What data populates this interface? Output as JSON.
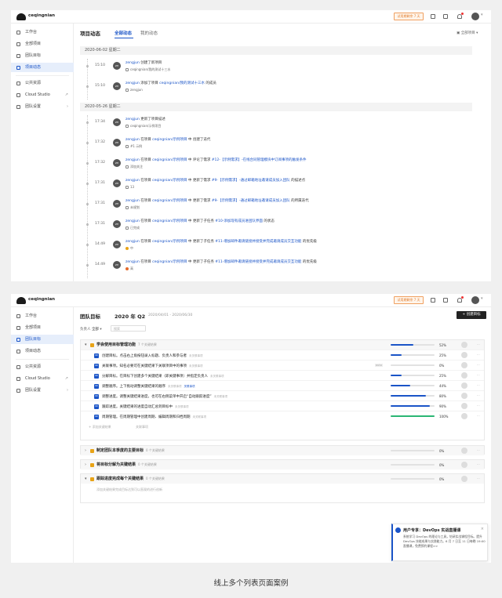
{
  "app": {
    "brand": "ceqingnian",
    "trial": "试用期剩余 7 天",
    "user_avatar": "ZH"
  },
  "sidebar": {
    "items": [
      {
        "label": "工作台"
      },
      {
        "label": "全部项目"
      },
      {
        "label": "团队目标"
      },
      {
        "label": "项目动态"
      },
      {
        "label": "公共资源"
      },
      {
        "label": "Cloud Studio",
        "arrow": "↗"
      },
      {
        "label": "团队设置",
        "arrow": "›"
      }
    ]
  },
  "activity": {
    "title": "项目动态",
    "tabs": [
      "全部动态",
      "我的动态"
    ],
    "filter": "全部项目",
    "groups": [
      {
        "date": "2020-06-02 星期二",
        "events": [
          {
            "time": "15:10",
            "avatar": "ZH",
            "line1": [
              {
                "t": "zengjun",
                "c": "blue"
              },
              {
                "t": " 创建了新项目",
                "c": ""
              }
            ],
            "line2": "ceqingnian/我的测试十三水"
          },
          {
            "time": "15:10",
            "avatar": "ZH",
            "line1": [
              {
                "t": "zengjun",
                "c": "blue"
              },
              {
                "t": " 添加了项目 ",
                "c": ""
              },
              {
                "t": "ceqingnian/我的测试十三水",
                "c": "blue"
              },
              {
                "t": " 的成员",
                "c": ""
              }
            ],
            "line2": "zengjun"
          }
        ]
      },
      {
        "date": "2020-05-26 星期二",
        "events": [
          {
            "time": "17:34",
            "avatar": "ZH",
            "line1": [
              {
                "t": "zengjun",
                "c": "blue"
              },
              {
                "t": " 更新了项目描述",
                "c": ""
              }
            ],
            "line2": "ceqingnian/示例项目"
          },
          {
            "time": "17:32",
            "avatar": "ZH",
            "line1": [
              {
                "t": "zengjun",
                "c": "blue"
              },
              {
                "t": " 在项目 ",
                "c": ""
              },
              {
                "t": "ceqingnian/示例项目",
                "c": "blue"
              },
              {
                "t": " 中 创建了迭代",
                "c": ""
              }
            ],
            "line2": "#1 示例"
          },
          {
            "time": "17:32",
            "avatar": "ZH",
            "line1": [
              {
                "t": "zengjun",
                "c": "blue"
              },
              {
                "t": " 在项目 ",
                "c": ""
              },
              {
                "t": "ceqingnian/示例项目",
                "c": "blue"
              },
              {
                "t": " 中 评论了需求 ",
                "c": ""
              },
              {
                "t": "#12-【示例需求】-在线合同管理模块中订阅事项的触发条件",
                "c": "blue"
              }
            ],
            "line2": "添加关注"
          },
          {
            "time": "17:31",
            "avatar": "ZH",
            "line1": [
              {
                "t": "zengjun",
                "c": "blue"
              },
              {
                "t": " 在项目 ",
                "c": ""
              },
              {
                "t": "ceqingnian/示例项目",
                "c": "blue"
              },
              {
                "t": " 中 更新了需求 ",
                "c": ""
              },
              {
                "t": "#9-【示例需求】-通过邮箱地址邀请成员加入团队",
                "c": "blue"
              },
              {
                "t": " 的描述点",
                "c": ""
              }
            ],
            "line2": "13"
          },
          {
            "time": "17:31",
            "avatar": "ZH",
            "line1": [
              {
                "t": "zengjun",
                "c": "blue"
              },
              {
                "t": " 在项目 ",
                "c": ""
              },
              {
                "t": "ceqingnian/示例项目",
                "c": "blue"
              },
              {
                "t": " 中 更新了需求 ",
                "c": ""
              },
              {
                "t": "#9-【示例需求】-通过邮箱地址邀请成员加入团队",
                "c": "blue"
              },
              {
                "t": " 的所属迭代",
                "c": ""
              }
            ],
            "line2": "未规划"
          },
          {
            "time": "17:31",
            "avatar": "ZH",
            "line1": [
              {
                "t": "zengjun",
                "c": "blue"
              },
              {
                "t": " 在项目 ",
                "c": ""
              },
              {
                "t": "ceqingnian/示例项目",
                "c": "blue"
              },
              {
                "t": " 中 更新了子任务 ",
                "c": ""
              },
              {
                "t": "#10-添加现有成员进团队界面",
                "c": "blue"
              },
              {
                "t": " 的状态",
                "c": ""
              }
            ],
            "line2": "已完成"
          },
          {
            "time": "14:49",
            "avatar": "ZH",
            "line1": [
              {
                "t": "zengjun",
                "c": "blue"
              },
              {
                "t": " 在项目 ",
                "c": ""
              },
              {
                "t": "ceqingnian/示例项目",
                "c": "blue"
              },
              {
                "t": " 中 更新了子任务 ",
                "c": ""
              },
              {
                "t": "#11-增加邮件邀请链接并接受并完成邀请成员交互功能",
                "c": "blue"
              },
              {
                "t": " 的优先级",
                "c": ""
              }
            ],
            "line2": "中",
            "pri": "mid"
          },
          {
            "time": "14:49",
            "avatar": "ZH",
            "line1": [
              {
                "t": "zengjun",
                "c": "blue"
              },
              {
                "t": " 在项目 ",
                "c": ""
              },
              {
                "t": "ceqingnian/示例项目",
                "c": "blue"
              },
              {
                "t": " 中 更新了子任务 ",
                "c": ""
              },
              {
                "t": "#11-增加邮件邀请链接并接受并完成邀请成员交互功能",
                "c": "blue"
              },
              {
                "t": " 的优先级",
                "c": ""
              }
            ],
            "line2": "高",
            "pri": "high"
          }
        ]
      }
    ]
  },
  "okr": {
    "title": "团队目标",
    "quarter": "2020 年 Q2",
    "range": "2020/04/01 - 2020/06/30",
    "create": "+ 创建目标",
    "owner_label": "负责人",
    "owner_value": "全部",
    "search_placeholder": "搜索",
    "objectives": [
      {
        "title": "学会使用目标管理功能",
        "count": "7 个关键结果",
        "progress": 52,
        "progress_label": "52%",
        "krs": [
          {
            "text": "创建目标。点击右上角按钮录入标题、负责人和参与者",
            "tag": "未关联事项",
            "progress": 25,
            "label": "25%"
          },
          {
            "text": "关联事项。知名必要可在关键结果下关联项目中的事项",
            "tag": "未关联事项",
            "progress": 0,
            "label": "0%",
            "badge": "auto"
          },
          {
            "text": "分解目标。在目标下创建多个关键结果（即关键事项）并指定负责人",
            "tag": "未关联事项",
            "progress": 25,
            "label": "25%"
          },
          {
            "text": "调整顺序。上下拖动调整关键结果的顺序",
            "tag": "未关联事项",
            "task": "关联事项",
            "progress": 44,
            "label": "44%"
          },
          {
            "text": "调整进度。调整关键结果进度，也可在右侧菜单中开启“自动跟踪进度”",
            "tag": "未关联事项",
            "progress": 80,
            "label": "80%"
          },
          {
            "text": "跟踪进度。关键结果的进度自动汇总到目标中",
            "tag": "未关联事项",
            "progress": 90,
            "label": "90%"
          },
          {
            "text": "周期管理。在周期管理中创建周期、编辑周期和归档周期",
            "tag": "未关联事项",
            "progress": 100,
            "label": "100%"
          }
        ],
        "add_kr": "+ 添加关键结果",
        "add_task": "关联事项"
      },
      {
        "title": "制定团队本季度的主要目标",
        "count": "0 个关键结果",
        "progress": 0,
        "progress_label": "0%"
      },
      {
        "title": "将目标分解为关键结果",
        "count": "0 个关键结果",
        "progress": 0,
        "progress_label": "0%"
      },
      {
        "title": "跟踪进度完成每个关键结果",
        "count": "0 个关键结果",
        "progress": 0,
        "progress_label": "0%",
        "hint": "添加关键结果完成目标达到可以直观的进行创新"
      }
    ]
  },
  "notification": {
    "title": "用户专享：DevOps 实战直播课",
    "body": "系统学习 DevOps 的理论与工具，钻研实战课程目标。提升 DevOps 技能成果与实践能力。6 月 7 日至 11 日每晚 19:00 直播课，免费预约课程>>"
  },
  "caption": "线上多个列表页面案例"
}
